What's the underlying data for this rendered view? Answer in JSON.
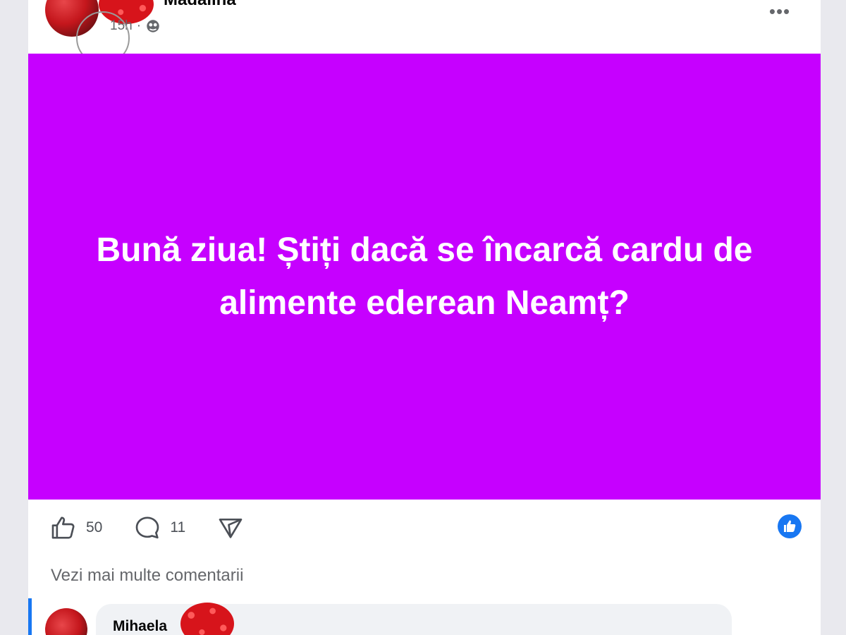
{
  "post": {
    "author": "Madalina",
    "time": "15h",
    "visibility_icon": "globe-icon",
    "more_label": "•••",
    "text": "Bună ziua! Știți dacă se încarcă cardu de alimente ederean Neamț?",
    "banner_color": "#c600ff"
  },
  "actions": {
    "likes": "50",
    "comments": "11"
  },
  "more_comments_label": "Vezi mai multe comentarii",
  "comment": {
    "author": "Mihaela"
  },
  "colors": {
    "accent": "#1877f2",
    "text": "#050505",
    "muted": "#65676b"
  }
}
